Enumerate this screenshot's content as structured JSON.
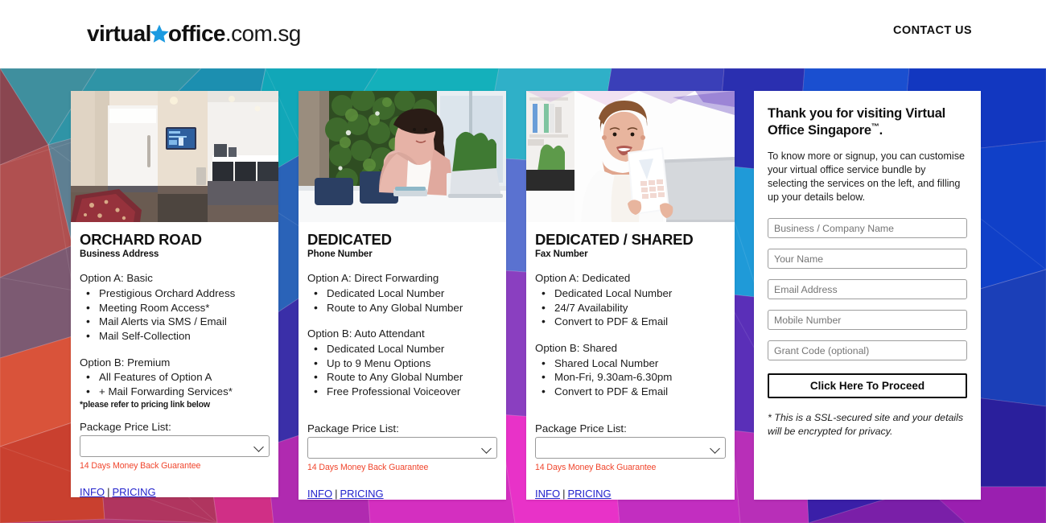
{
  "header": {
    "logo": {
      "part1": "virtual",
      "star_icon": "star-icon",
      "part2": "office",
      "part3": ".com.sg"
    },
    "contact_link": "CONTACT US"
  },
  "cards": [
    {
      "image_alt": "office-reception-photo",
      "title": "ORCHARD ROAD",
      "subtitle": "Business Address",
      "option_a_head": "Option A: Basic",
      "option_a_items": [
        "Prestigious Orchard Address",
        "Meeting Room Access*",
        "Mail Alerts via SMS / Email",
        "Mail Self-Collection"
      ],
      "option_b_head": "Option B: Premium",
      "option_b_items": [
        "All Features of Option A",
        "+ Mail Forwarding Services*"
      ],
      "note": "*please refer to pricing link below",
      "package_label": "Package Price List:",
      "package_value": "",
      "guarantee": "14 Days Money Back Guarantee",
      "info_link": "INFO",
      "separator": "|",
      "pricing_link": "PRICING"
    },
    {
      "image_alt": "woman-on-phone-photo",
      "title": "DEDICATED",
      "subtitle": "Phone Number",
      "option_a_head": "Option A: Direct Forwarding",
      "option_a_items": [
        "Dedicated Local Number",
        "Route to Any Global Number"
      ],
      "option_b_head": "Option B: Auto Attendant",
      "option_b_items": [
        "Dedicated Local Number",
        "Up to 9 Menu Options",
        "Route to Any Global Number",
        "Free Professional Voiceover"
      ],
      "note": "",
      "package_label": "Package Price List:",
      "package_value": "",
      "guarantee": "14 Days Money Back Guarantee",
      "info_link": "INFO",
      "separator": "|",
      "pricing_link": "PRICING"
    },
    {
      "image_alt": "woman-holding-document-photo",
      "title": "DEDICATED / SHARED",
      "subtitle": "Fax Number",
      "option_a_head": "Option A: Dedicated",
      "option_a_items": [
        "Dedicated Local Number",
        "24/7 Availability",
        "Convert to PDF & Email"
      ],
      "option_b_head": "Option B: Shared",
      "option_b_items": [
        "Shared Local Number",
        "Mon-Fri, 9.30am-6.30pm",
        "Convert to PDF & Email"
      ],
      "note": "",
      "package_label": "Package Price List:",
      "package_value": "",
      "guarantee": "14 Days Money Back Guarantee",
      "info_link": "INFO",
      "separator": "|",
      "pricing_link": "PRICING"
    }
  ],
  "form": {
    "title": "Thank you for visiting Virtual Office Singapore™.",
    "description": "To know more or signup, you can customise your virtual office service bundle by selecting the services on the left, and filling up your details below.",
    "fields": {
      "company_placeholder": "Business / Company Name",
      "company_value": "",
      "name_placeholder": "Your Name",
      "name_value": "",
      "email_placeholder": "Email Address",
      "email_value": "",
      "mobile_placeholder": "Mobile Number",
      "mobile_value": "",
      "grant_placeholder": "Grant Code (optional)",
      "grant_value": ""
    },
    "submit_label": "Click Here To Proceed",
    "ssl_note": "* This is a SSL-secured site and your details will be encrypted for privacy."
  },
  "colors": {
    "link_blue": "#2222cc",
    "guarantee_red": "#f0462d",
    "logo_star_blue": "#1b9ae0",
    "bg_orange": "#e8642f",
    "bg_teal": "#3b8a99",
    "bg_magenta": "#e832c8",
    "bg_blue": "#1344c4",
    "bg_purple": "#5a25a8"
  }
}
